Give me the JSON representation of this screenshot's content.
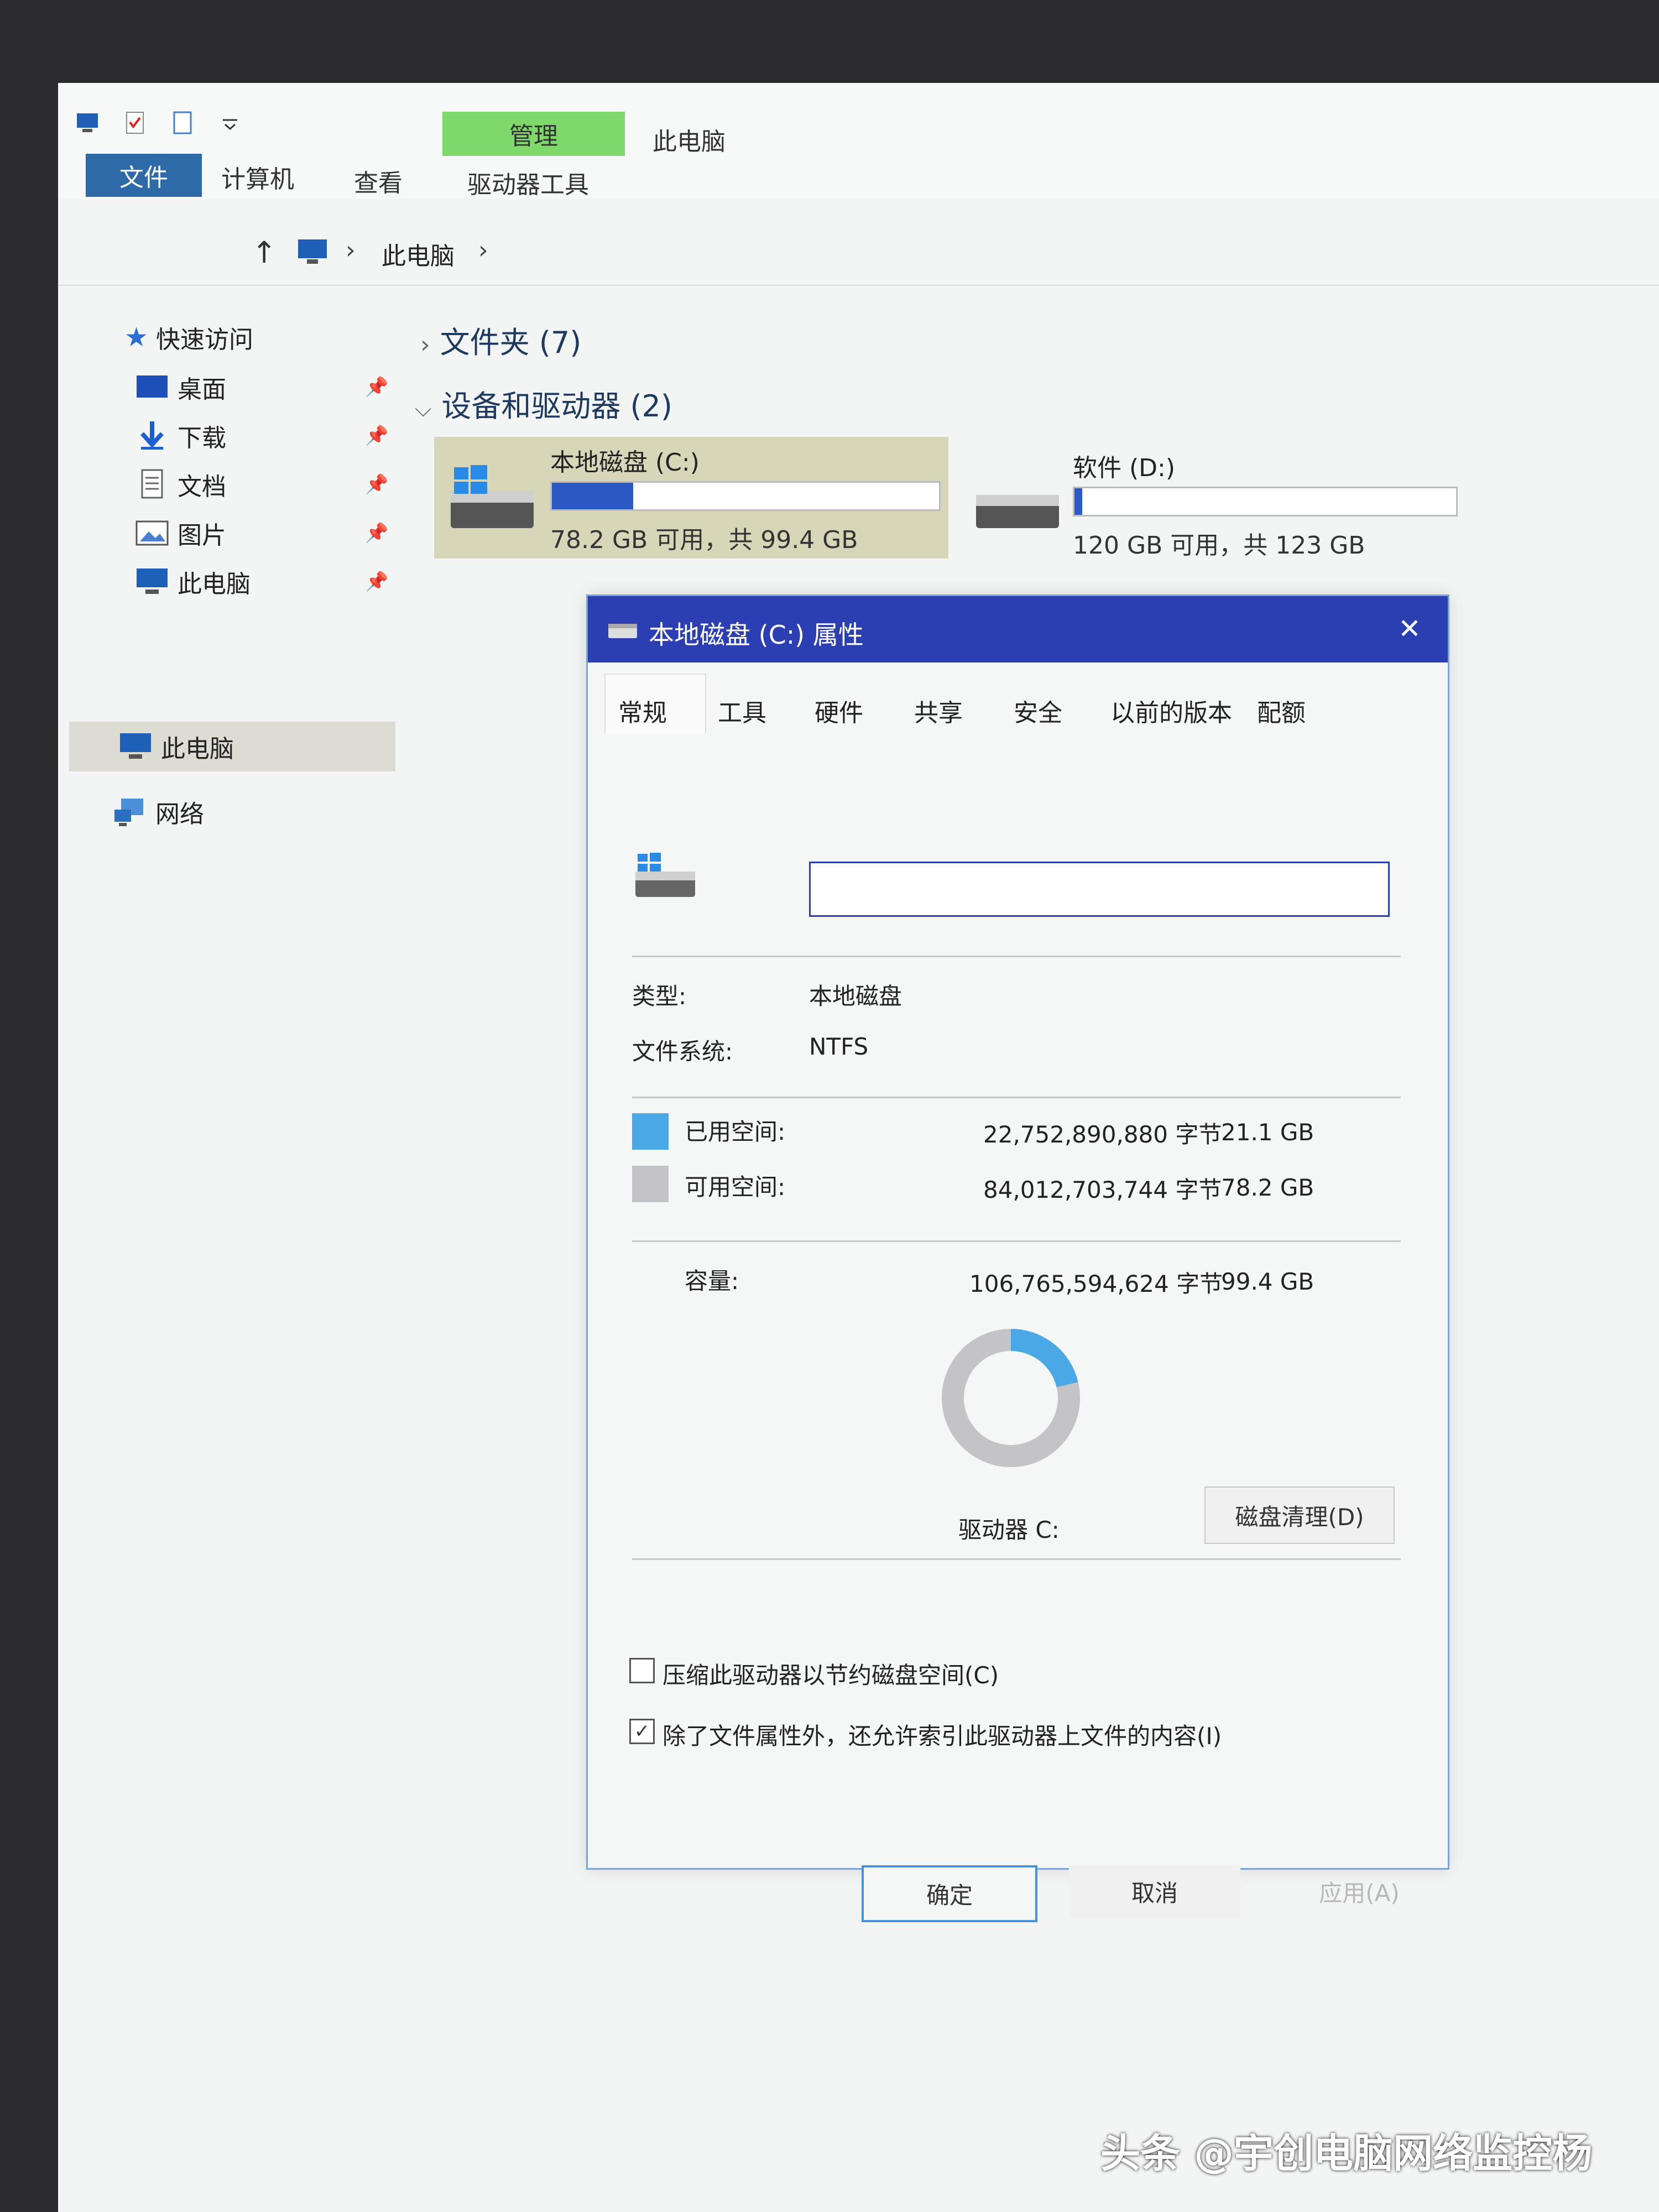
{
  "ribbon": {
    "file_tab": "文件",
    "tab_computer": "计算机",
    "tab_view": "查看",
    "manage_context": "管理",
    "drive_tools": "驱动器工具",
    "window_title": "此电脑"
  },
  "address": {
    "crumb": "此电脑",
    "sep": "›"
  },
  "nav": {
    "quick_access": "快速访问",
    "items": [
      {
        "label": "桌面",
        "icon": "desktop-icon"
      },
      {
        "label": "下载",
        "icon": "download-icon"
      },
      {
        "label": "文档",
        "icon": "document-icon"
      },
      {
        "label": "图片",
        "icon": "picture-icon"
      },
      {
        "label": "此电脑",
        "icon": "computer-icon"
      }
    ],
    "this_pc": "此电脑",
    "network": "网络"
  },
  "groups": {
    "folders": "文件夹 (7)",
    "devices": "设备和驱动器 (2)"
  },
  "drives": [
    {
      "name": "本地磁盘 (C:)",
      "info": "78.2 GB 可用，共 99.4 GB",
      "used_fraction": 0.21
    },
    {
      "name": "软件 (D:)",
      "info": "120 GB 可用，共 123 GB",
      "used_fraction": 0.02
    }
  ],
  "dialog": {
    "title": "本地磁盘 (C:) 属性",
    "close": "✕",
    "tabs": [
      "常规",
      "工具",
      "硬件",
      "共享",
      "安全",
      "以前的版本",
      "配额"
    ],
    "name_value": "",
    "type_label": "类型:",
    "type_value": "本地磁盘",
    "fs_label": "文件系统:",
    "fs_value": "NTFS",
    "used_label": "已用空间:",
    "used_bytes": "22,752,890,880 字节",
    "used_gb": "21.1 GB",
    "free_label": "可用空间:",
    "free_bytes": "84,012,703,744 字节",
    "free_gb": "78.2 GB",
    "cap_label": "容量:",
    "cap_bytes": "106,765,594,624 字节",
    "cap_gb": "99.4 GB",
    "used_fraction": 0.213,
    "drive_label": "驱动器 C:",
    "cleanup_button": "磁盘清理(D)",
    "compress_label": "压缩此驱动器以节约磁盘空间(C)",
    "compress_checked": false,
    "index_label": "除了文件属性外，还允许索引此驱动器上文件的内容(I)",
    "index_checked": true,
    "ok": "确定",
    "cancel": "取消",
    "apply": "应用(A)"
  },
  "colors": {
    "accent": "#2b3fb3",
    "used": "#4aa8e6",
    "free": "#c4c4c8",
    "manage": "#7fd96a"
  },
  "watermark": "头条 @宇创电脑网络监控杨"
}
